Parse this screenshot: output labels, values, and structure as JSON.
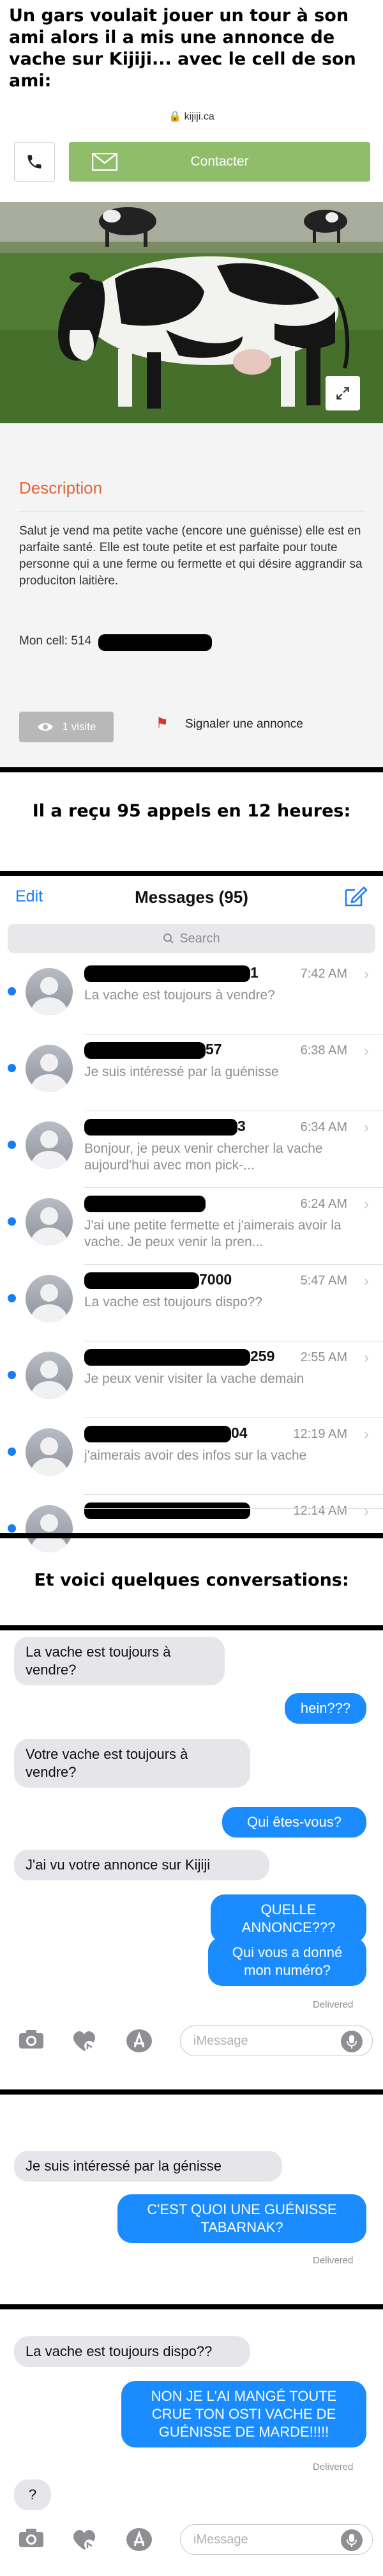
{
  "captions": {
    "top": "Un gars voulait jouer un tour à son ami alors il a mis une annonce de vache sur Kijiji... avec le cell de son ami:",
    "middle": "Il a reçu 95 appels en 12 heures:",
    "convos": "Et voici quelques conversations:"
  },
  "kijiji": {
    "url": "kijiji.ca",
    "contact_label": "Contacter",
    "description_title": "Description",
    "description_text": "Salut je vend ma petite vache (encore une guénisse) elle est en parfaite santé. Elle est toute petite et est parfaite pour toute personne qui a une ferme ou fermette et qui désire aggrandir sa produciton laitière.",
    "cell_prefix": "Mon cell: 514",
    "visits": "1 visite",
    "report": "Signaler une annonce",
    "accent": "#e0663a",
    "button_color": "#8fbd6a"
  },
  "messages": {
    "edit": "Edit",
    "title": "Messages (95)",
    "search_placeholder": "Search",
    "threads": [
      {
        "name_visible": "1",
        "time": "7:42 AM",
        "preview": "La vache est toujours à vendre?"
      },
      {
        "name_visible": "57",
        "time": "6:38 AM",
        "preview": "Je suis intéressé par la guénisse"
      },
      {
        "name_visible": "3",
        "time": "6:34 AM",
        "preview": "Bonjour, je peux venir chercher la vache aujourd'hui avec mon pick-..."
      },
      {
        "name_visible": "",
        "time": "6:24 AM",
        "preview": "J'ai une petite fermette et j'aimerais avoir la vache. Je peux venir la pren..."
      },
      {
        "name_visible": "7000",
        "time": "5:47 AM",
        "preview": "La vache est toujours dispo??"
      },
      {
        "name_visible": "259",
        "time": "2:55 AM",
        "preview": "Je peux venir visiter la vache demain"
      },
      {
        "name_visible": "04",
        "time": "12:19 AM",
        "preview": "j'aimerais avoir des infos sur la vache"
      },
      {
        "name_visible": "",
        "time": "12:14 AM",
        "preview": ""
      }
    ],
    "accent": "#1a7cf5"
  },
  "conv1": {
    "m1": "La vache est toujours à vendre?",
    "m2": "hein???",
    "m3": "Votre vache est toujours à vendre?",
    "m4": "Qui êtes-vous?",
    "m5": "J'ai vu votre annonce sur Kijiji",
    "m6": "QUELLE ANNONCE???",
    "m7": "Qui vous a donné mon numéro?",
    "delivered": "Delivered",
    "input_placeholder": "iMessage"
  },
  "conv2": {
    "m1": "Je suis intéressé par la génisse",
    "m2": "C'EST QUOI UNE GUÉNISSE TABARNAK?",
    "delivered": "Delivered"
  },
  "conv3": {
    "m1": "La vache est toujours dispo??",
    "m2": "NON JE L'AI MANGÉ TOUTE CRUE TON OSTI VACHE DE GUÉNISSE DE MARDE!!!!!",
    "delivered": "Delivered",
    "m3": "?",
    "input_placeholder": "iMessage"
  }
}
